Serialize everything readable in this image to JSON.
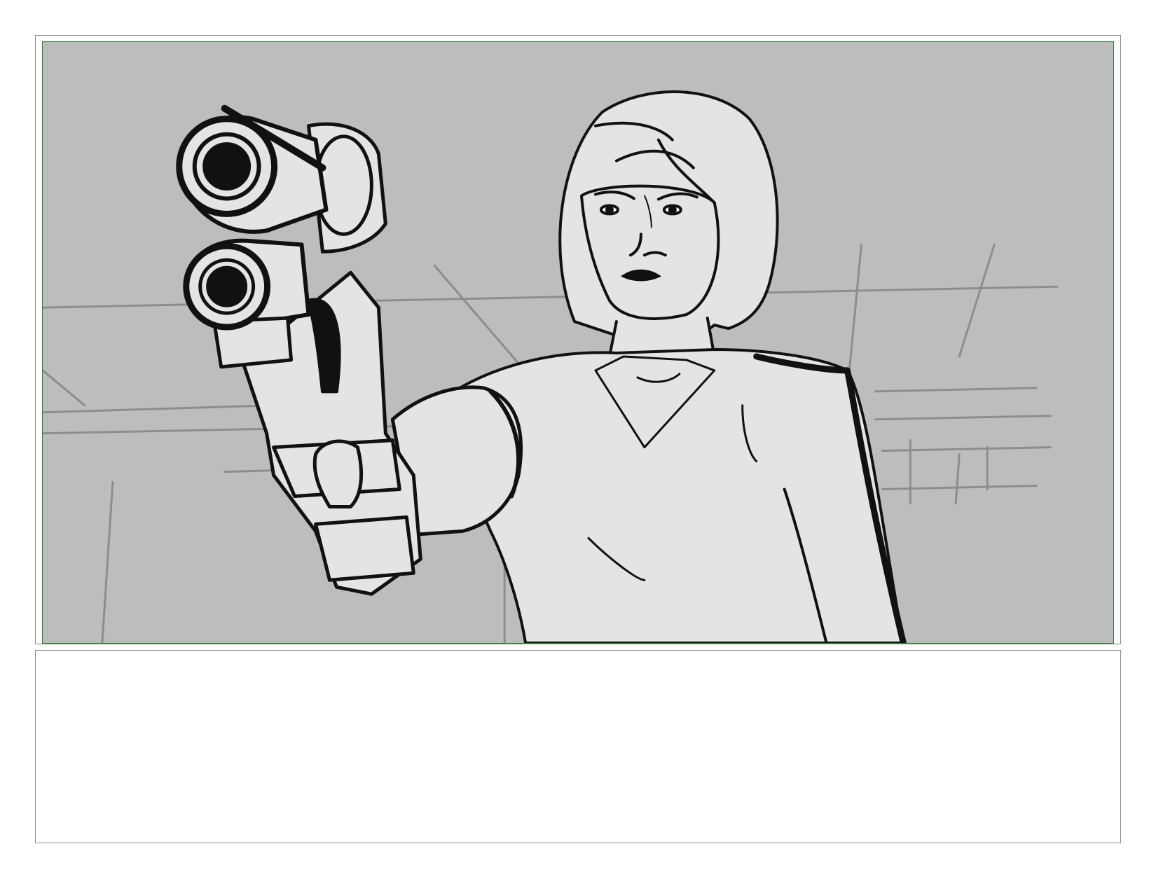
{
  "storyboard": {
    "panel": {
      "description_icon": "storyboard-sketch-woman-aiming-gun",
      "background_color": "#bdbdbd",
      "figure_fill": "#e4e4e4",
      "ink_color": "#111111",
      "frame_border_color": "#2e7d32"
    },
    "caption": {
      "text": ""
    }
  }
}
